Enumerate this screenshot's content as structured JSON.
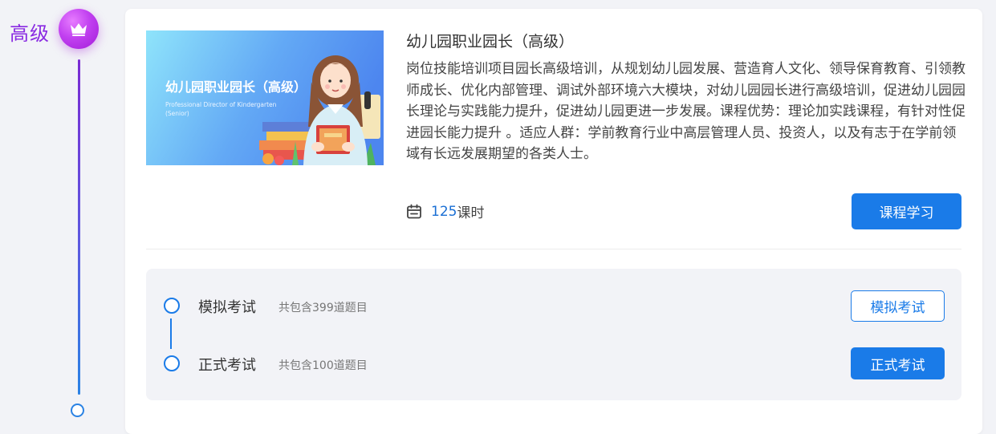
{
  "level": {
    "label": "高级",
    "icon": "crown-icon"
  },
  "course": {
    "thumbnail": {
      "title": "幼儿园职业园长（高级）",
      "subtitle_line1": "Professional Director of Kindergarten",
      "subtitle_line2": "(Senior)"
    },
    "title": "幼儿园职业园长（高级）",
    "description": "岗位技能培训项目园长高级培训，从规划幼儿园发展、营造育人文化、领导保育教育、引领教师成长、优化内部管理、调试外部环境六大模块，对幼儿园园长进行高级培训，促进幼儿园园长理论与实践能力提升，促进幼儿园更进一步发展。课程优势：理论加实践课程，有针对性促进园长能力提升 。适应人群：学前教育行业中高层管理人员、投资人，以及有志于在学前领域有长远发展期望的各类人士。",
    "hours_value": "125",
    "hours_unit": "课时",
    "study_button": "课程学习"
  },
  "exams": [
    {
      "name": "模拟考试",
      "count": "共包含399道题目",
      "button": "模拟考试",
      "style": "outline"
    },
    {
      "name": "正式考试",
      "count": "共包含100道题目",
      "button": "正式考试",
      "style": "primary"
    }
  ],
  "colors": {
    "accent": "#1a7be8",
    "level_purple": "#8a2be2",
    "background": "#f2f3f7"
  }
}
